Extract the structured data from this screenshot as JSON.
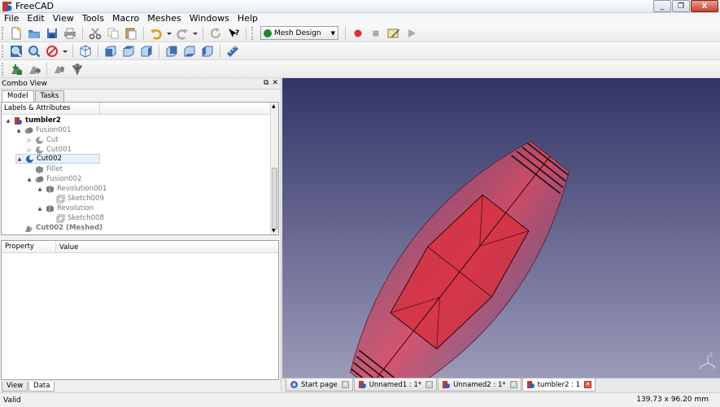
{
  "window": {
    "title": "FreeCAD",
    "controls": [
      "_",
      "❐",
      "X"
    ]
  },
  "menubar": [
    {
      "label": "File",
      "key": "F"
    },
    {
      "label": "Edit",
      "key": "E"
    },
    {
      "label": "View",
      "key": "V"
    },
    {
      "label": "Tools",
      "key": "T"
    },
    {
      "label": "Macro",
      "key": "M"
    },
    {
      "label": "Meshes",
      "key": "M"
    },
    {
      "label": "Windows",
      "key": "W"
    },
    {
      "label": "Help",
      "key": "H"
    }
  ],
  "workbench": {
    "selected": "Mesh Design",
    "color": "#1c8a2c"
  },
  "combo_view": {
    "title": "Combo View",
    "tabs": [
      "Model",
      "Tasks"
    ],
    "active_tab": "Model",
    "tree_header": "Labels & Attributes",
    "tree": [
      {
        "label": "tumbler2",
        "depth": 0,
        "arrow": "▲",
        "icon": "document-icon",
        "style": "bold"
      },
      {
        "label": "Fusion001",
        "depth": 1,
        "arrow": "▲",
        "icon": "part-fusion-icon",
        "style": "dim"
      },
      {
        "label": "Cut",
        "depth": 2,
        "arrow": "▷",
        "icon": "part-cut-icon",
        "style": "dim"
      },
      {
        "label": "Cut001",
        "depth": 2,
        "arrow": "▷",
        "icon": "part-cut-icon",
        "style": "dim"
      },
      {
        "label": "Cut002",
        "depth": 1,
        "arrow": "▲",
        "icon": "part-cut-icon",
        "style": "selected"
      },
      {
        "label": "Fillet",
        "depth": 2,
        "arrow": "",
        "icon": "part-fillet-icon",
        "style": "dim"
      },
      {
        "label": "Fusion002",
        "depth": 2,
        "arrow": "▲",
        "icon": "part-fusion-icon",
        "style": "dim"
      },
      {
        "label": "Revolution001",
        "depth": 3,
        "arrow": "▲",
        "icon": "part-revolve-icon",
        "style": "dim"
      },
      {
        "label": "Sketch009",
        "depth": 4,
        "arrow": "",
        "icon": "sketch-icon",
        "style": "dim"
      },
      {
        "label": "Revolution",
        "depth": 3,
        "arrow": "▲",
        "icon": "part-revolve-icon",
        "style": "dim"
      },
      {
        "label": "Sketch008",
        "depth": 4,
        "arrow": "",
        "icon": "sketch-icon",
        "style": "dim"
      },
      {
        "label": "Cut002 (Meshed)",
        "depth": 1,
        "arrow": "",
        "icon": "mesh-icon",
        "style": "dim-bold"
      }
    ],
    "property_header": {
      "property": "Property",
      "value": "Value"
    },
    "bottom_tabs": [
      "View",
      "Data"
    ],
    "active_bottom_tab": "Data"
  },
  "document_tabs": [
    {
      "label": "Start page",
      "icon": "start-page-icon",
      "active": false
    },
    {
      "label": "Unnamed1 : 1*",
      "icon": "freecad-doc-icon",
      "active": false
    },
    {
      "label": "Unnamed2 : 1*",
      "icon": "freecad-doc-icon",
      "active": false
    },
    {
      "label": "tumbler2 : 1",
      "icon": "freecad-doc-icon",
      "active": true
    }
  ],
  "status": {
    "message": "Valid",
    "dimensions": "139.73 x 96.20 mm"
  },
  "axis_labels": {
    "x": "X",
    "y": "Y",
    "z": "Z"
  }
}
